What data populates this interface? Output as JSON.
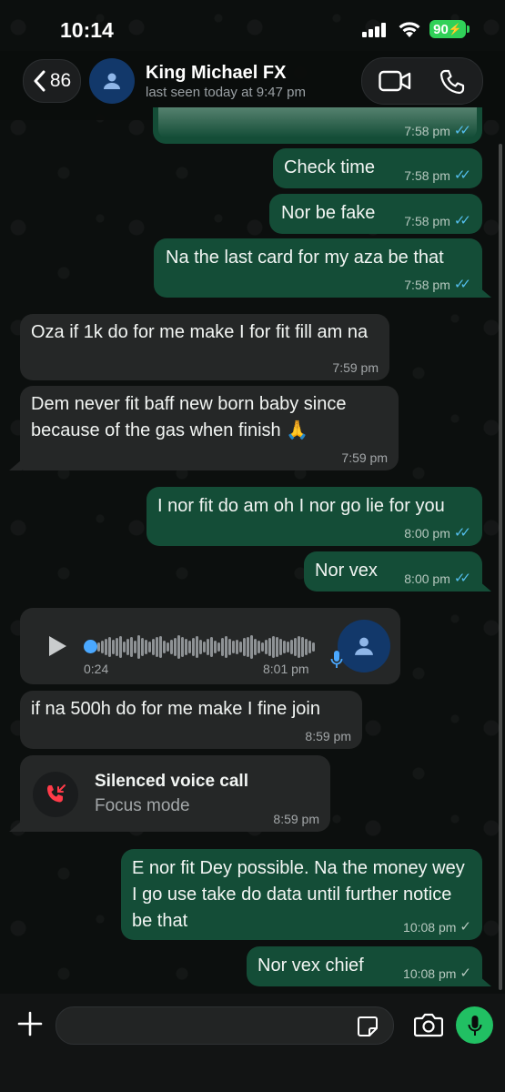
{
  "status_bar": {
    "time": "10:14",
    "battery": "90"
  },
  "header": {
    "back_count": "86",
    "contact_name": "King Michael FX",
    "last_seen": "last seen today at 9:47 pm"
  },
  "messages": [
    {
      "dir": "out",
      "text": "",
      "time": "7:58 pm",
      "status": "read"
    },
    {
      "dir": "out",
      "text": "Check time",
      "time": "7:58 pm",
      "status": "read"
    },
    {
      "dir": "out",
      "text": "Nor be fake",
      "time": "7:58 pm",
      "status": "read"
    },
    {
      "dir": "out",
      "text": "Na the last card for my aza be that",
      "time": "7:58 pm",
      "status": "read"
    },
    {
      "dir": "in",
      "text": "Oza if 1k do for me make I for fit fill am na",
      "time": "7:59 pm"
    },
    {
      "dir": "in",
      "text": "Dem never fit baff new born baby since because of the gas when finish 🙏",
      "time": "7:59 pm"
    },
    {
      "dir": "out",
      "text": "I nor fit do am oh I nor go lie for you",
      "time": "8:00 pm",
      "status": "read"
    },
    {
      "dir": "out",
      "text": "Nor vex",
      "time": "8:00 pm",
      "status": "read"
    },
    {
      "dir": "in",
      "type": "voice",
      "duration": "0:24",
      "time": "8:01 pm"
    },
    {
      "dir": "in",
      "text": "if na 500h do for me make I fine join",
      "time": "8:59 pm"
    },
    {
      "dir": "in",
      "type": "call",
      "title": "Silenced voice call",
      "subtitle": "Focus mode",
      "time": "8:59 pm"
    },
    {
      "dir": "out",
      "text": "E nor fit Dey possible. Na the money wey I go use take do data until further notice be that",
      "time": "10:08 pm",
      "status": "sent"
    },
    {
      "dir": "out",
      "text": "Nor vex chief",
      "time": "10:08 pm",
      "status": "sent"
    }
  ],
  "colors": {
    "outgoing": "#144d37",
    "incoming": "#252727",
    "read_ticks": "#53bdeb",
    "accent": "#21c063"
  },
  "icons": [
    "back-chevron",
    "avatar-person",
    "video-icon",
    "phone-icon",
    "play-icon",
    "mic-icon",
    "missed-call-icon",
    "plus-icon",
    "sticker-icon",
    "camera-icon"
  ]
}
